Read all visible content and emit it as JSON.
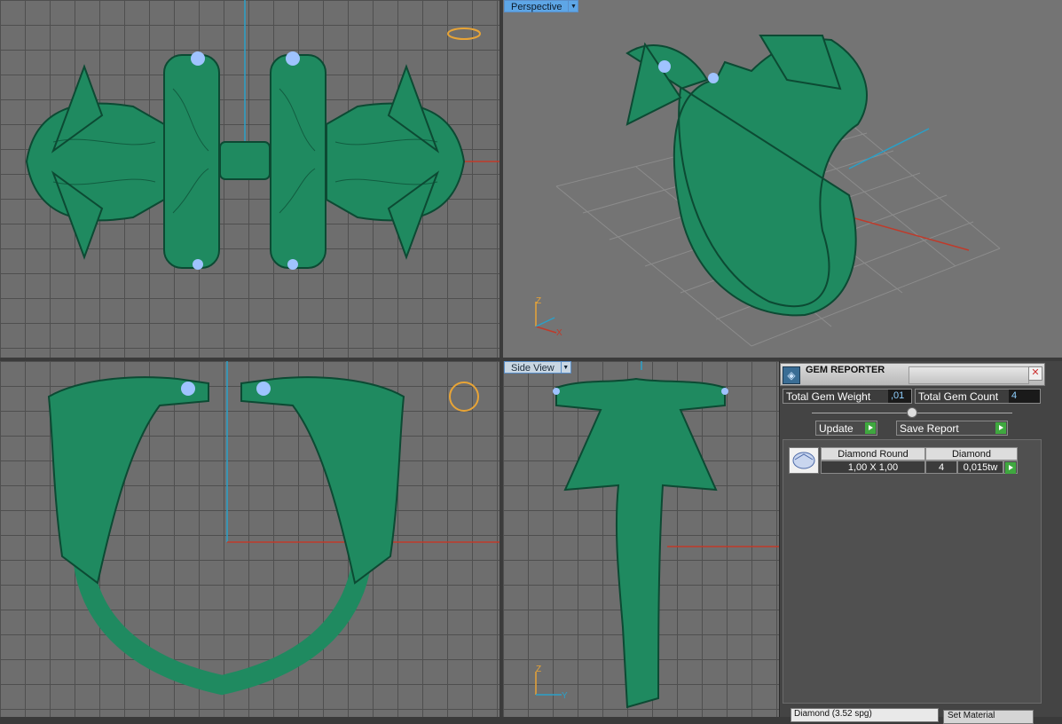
{
  "viewports": {
    "top": {
      "label": ""
    },
    "perspective": {
      "label": "Perspective"
    },
    "front": {
      "label": ""
    },
    "side": {
      "label": "Side View"
    }
  },
  "axis_labels": {
    "persp_z": "Z",
    "persp_x": "X",
    "side_z": "Z",
    "side_y": "Y"
  },
  "gem_reporter": {
    "title": "GEM REPORTER",
    "total_weight_label": "Total Gem Weight",
    "total_weight_value": ",01",
    "total_count_label": "Total Gem Count",
    "total_count_value": "4",
    "update_label": "Update",
    "save_label": "Save Report",
    "row": {
      "name": "Diamond Round",
      "size": "1,00 X 1,00",
      "material": "Diamond",
      "count": "4",
      "weight": "0,015tw"
    },
    "bottom_select": "Diamond    (3.52 spg)",
    "set_material_label": "Set Material"
  },
  "colors": {
    "ring": "#1f8a60",
    "ring_dark": "#0c4a33",
    "gem": "#9fc3ff",
    "active_label": "#5ea6e6"
  }
}
